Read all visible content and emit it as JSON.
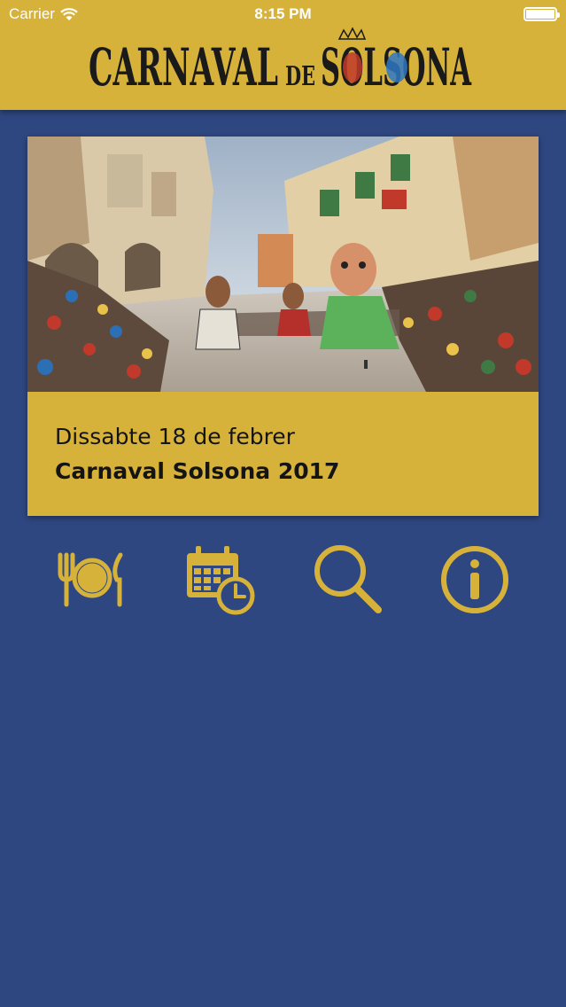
{
  "status_bar": {
    "carrier": "Carrier",
    "time": "8:15 PM"
  },
  "header": {
    "logo_text_left": "CARNAVAL",
    "logo_text_mid": "DE",
    "logo_text_right": "SOLSONA"
  },
  "event_card": {
    "date": "Dissabte 18 de febrer",
    "title": "Carnaval Solsona 2017"
  },
  "colors": {
    "background": "#2e4780",
    "accent": "#d7b23b",
    "text_dark": "#141414"
  },
  "toolbar": {
    "items": [
      {
        "icon": "restaurant-icon"
      },
      {
        "icon": "calendar-clock-icon"
      },
      {
        "icon": "search-icon"
      },
      {
        "icon": "info-icon"
      }
    ]
  }
}
